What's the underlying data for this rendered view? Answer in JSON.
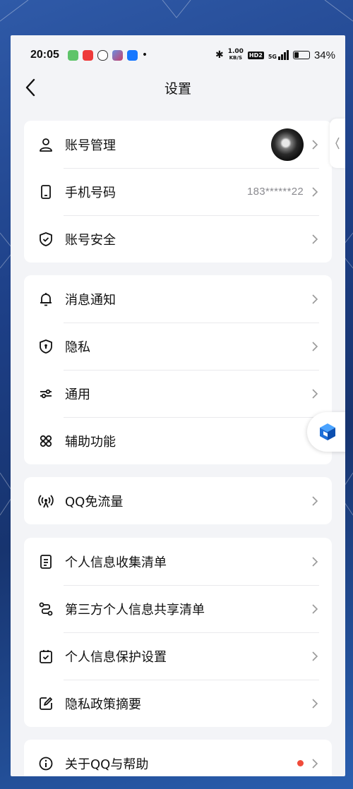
{
  "status_bar": {
    "time": "20:05",
    "net_speed_top": "1.00",
    "net_speed_bottom": "KB/S",
    "hd_badge": "HD2",
    "signal": "5G",
    "battery": "34%",
    "battery_level": 0.34,
    "app_icons": [
      "green-app-icon",
      "music-app-icon",
      "wechat-icon",
      "game-app-icon",
      "alipay-icon"
    ]
  },
  "nav": {
    "title": "设置"
  },
  "groups": [
    {
      "rows": [
        {
          "label": "账号管理",
          "icon": "user-icon",
          "right": "avatar"
        },
        {
          "label": "手机号码",
          "icon": "phone-icon",
          "value": "183******22"
        },
        {
          "label": "账号安全",
          "icon": "shield-check-icon"
        }
      ]
    },
    {
      "rows": [
        {
          "label": "消息通知",
          "icon": "bell-icon"
        },
        {
          "label": "隐私",
          "icon": "privacy-shield-icon"
        },
        {
          "label": "通用",
          "icon": "sliders-icon"
        },
        {
          "label": "辅助功能",
          "icon": "grid-icon"
        }
      ]
    },
    {
      "rows": [
        {
          "label": "QQ免流量",
          "icon": "broadcast-icon"
        }
      ]
    },
    {
      "rows": [
        {
          "label": "个人信息收集清单",
          "icon": "document-icon"
        },
        {
          "label": "第三方个人信息共享清单",
          "icon": "share-icon"
        },
        {
          "label": "个人信息保护设置",
          "icon": "checkbox-icon"
        },
        {
          "label": "隐私政策摘要",
          "icon": "edit-icon"
        }
      ]
    },
    {
      "rows": [
        {
          "label": "关于QQ与帮助",
          "icon": "info-icon",
          "right": "red-dot"
        }
      ]
    }
  ],
  "colors": {
    "accent_blue": "#1e6fd9",
    "badge_red": "#f04b3a",
    "background": "#f3f4f7"
  }
}
